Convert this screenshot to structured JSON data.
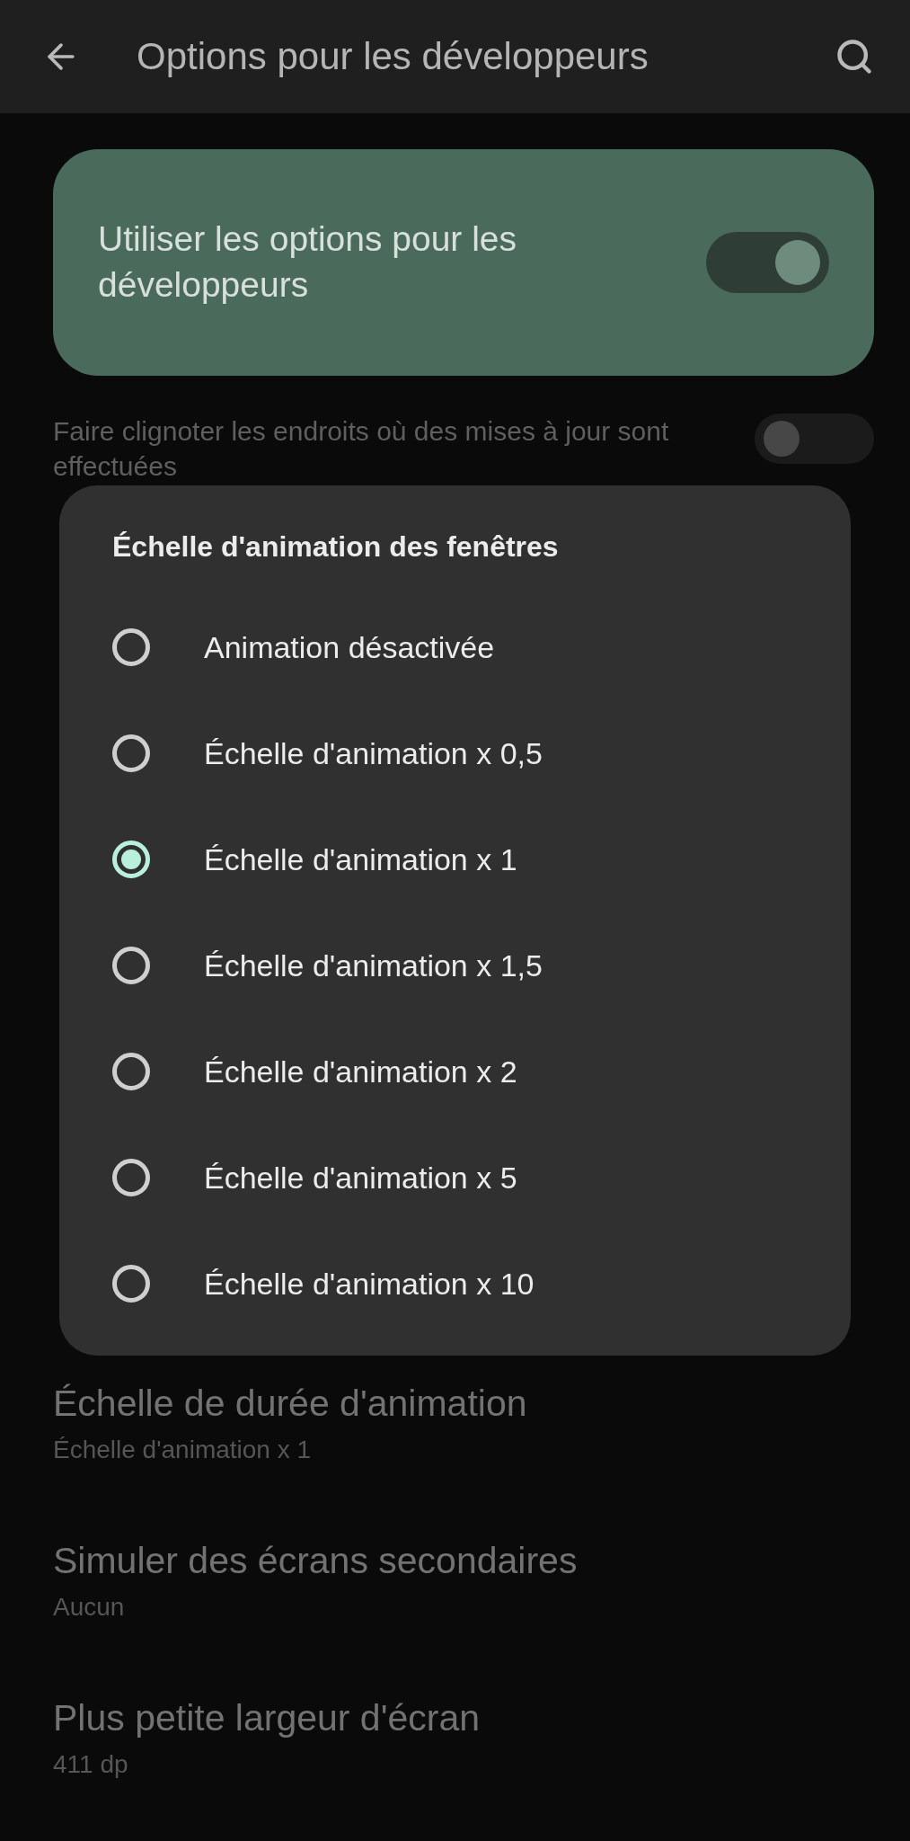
{
  "app_bar": {
    "title": "Options pour les développeurs"
  },
  "master_switch": {
    "label": "Utiliser les options pour les développeurs",
    "on": true
  },
  "settings_before": [
    {
      "summary": "Faire clignoter les endroits où des mises à jour sont effectuées",
      "on": false
    }
  ],
  "dialog": {
    "title": "Échelle d'animation des fenêtres",
    "options": [
      {
        "label": "Animation désactivée",
        "selected": false
      },
      {
        "label": "Échelle d'animation x 0,5",
        "selected": false
      },
      {
        "label": "Échelle d'animation x 1",
        "selected": true
      },
      {
        "label": "Échelle d'animation x 1,5",
        "selected": false
      },
      {
        "label": "Échelle d'animation x 2",
        "selected": false
      },
      {
        "label": "Échelle d'animation x 5",
        "selected": false
      },
      {
        "label": "Échelle d'animation x 10",
        "selected": false
      }
    ]
  },
  "settings_after": [
    {
      "title": "Échelle de durée d'animation",
      "summary": "Échelle d'animation x 1"
    },
    {
      "title": "Simuler des écrans secondaires",
      "summary": "Aucun"
    },
    {
      "title": "Plus petite largeur d'écran",
      "summary": "411 dp"
    }
  ]
}
